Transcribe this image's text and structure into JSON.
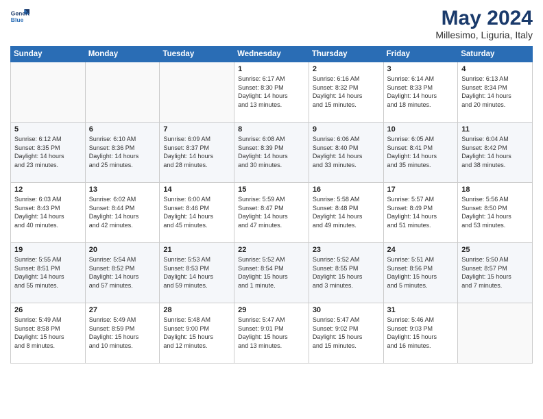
{
  "logo": {
    "text_line1": "General",
    "text_line2": "Blue"
  },
  "calendar": {
    "title": "May 2024",
    "subtitle": "Millesimo, Liguria, Italy",
    "days_of_week": [
      "Sunday",
      "Monday",
      "Tuesday",
      "Wednesday",
      "Thursday",
      "Friday",
      "Saturday"
    ],
    "weeks": [
      [
        {
          "day": "",
          "info": ""
        },
        {
          "day": "",
          "info": ""
        },
        {
          "day": "",
          "info": ""
        },
        {
          "day": "1",
          "info": "Sunrise: 6:17 AM\nSunset: 8:30 PM\nDaylight: 14 hours\nand 13 minutes."
        },
        {
          "day": "2",
          "info": "Sunrise: 6:16 AM\nSunset: 8:32 PM\nDaylight: 14 hours\nand 15 minutes."
        },
        {
          "day": "3",
          "info": "Sunrise: 6:14 AM\nSunset: 8:33 PM\nDaylight: 14 hours\nand 18 minutes."
        },
        {
          "day": "4",
          "info": "Sunrise: 6:13 AM\nSunset: 8:34 PM\nDaylight: 14 hours\nand 20 minutes."
        }
      ],
      [
        {
          "day": "5",
          "info": "Sunrise: 6:12 AM\nSunset: 8:35 PM\nDaylight: 14 hours\nand 23 minutes."
        },
        {
          "day": "6",
          "info": "Sunrise: 6:10 AM\nSunset: 8:36 PM\nDaylight: 14 hours\nand 25 minutes."
        },
        {
          "day": "7",
          "info": "Sunrise: 6:09 AM\nSunset: 8:37 PM\nDaylight: 14 hours\nand 28 minutes."
        },
        {
          "day": "8",
          "info": "Sunrise: 6:08 AM\nSunset: 8:39 PM\nDaylight: 14 hours\nand 30 minutes."
        },
        {
          "day": "9",
          "info": "Sunrise: 6:06 AM\nSunset: 8:40 PM\nDaylight: 14 hours\nand 33 minutes."
        },
        {
          "day": "10",
          "info": "Sunrise: 6:05 AM\nSunset: 8:41 PM\nDaylight: 14 hours\nand 35 minutes."
        },
        {
          "day": "11",
          "info": "Sunrise: 6:04 AM\nSunset: 8:42 PM\nDaylight: 14 hours\nand 38 minutes."
        }
      ],
      [
        {
          "day": "12",
          "info": "Sunrise: 6:03 AM\nSunset: 8:43 PM\nDaylight: 14 hours\nand 40 minutes."
        },
        {
          "day": "13",
          "info": "Sunrise: 6:02 AM\nSunset: 8:44 PM\nDaylight: 14 hours\nand 42 minutes."
        },
        {
          "day": "14",
          "info": "Sunrise: 6:00 AM\nSunset: 8:46 PM\nDaylight: 14 hours\nand 45 minutes."
        },
        {
          "day": "15",
          "info": "Sunrise: 5:59 AM\nSunset: 8:47 PM\nDaylight: 14 hours\nand 47 minutes."
        },
        {
          "day": "16",
          "info": "Sunrise: 5:58 AM\nSunset: 8:48 PM\nDaylight: 14 hours\nand 49 minutes."
        },
        {
          "day": "17",
          "info": "Sunrise: 5:57 AM\nSunset: 8:49 PM\nDaylight: 14 hours\nand 51 minutes."
        },
        {
          "day": "18",
          "info": "Sunrise: 5:56 AM\nSunset: 8:50 PM\nDaylight: 14 hours\nand 53 minutes."
        }
      ],
      [
        {
          "day": "19",
          "info": "Sunrise: 5:55 AM\nSunset: 8:51 PM\nDaylight: 14 hours\nand 55 minutes."
        },
        {
          "day": "20",
          "info": "Sunrise: 5:54 AM\nSunset: 8:52 PM\nDaylight: 14 hours\nand 57 minutes."
        },
        {
          "day": "21",
          "info": "Sunrise: 5:53 AM\nSunset: 8:53 PM\nDaylight: 14 hours\nand 59 minutes."
        },
        {
          "day": "22",
          "info": "Sunrise: 5:52 AM\nSunset: 8:54 PM\nDaylight: 15 hours\nand 1 minute."
        },
        {
          "day": "23",
          "info": "Sunrise: 5:52 AM\nSunset: 8:55 PM\nDaylight: 15 hours\nand 3 minutes."
        },
        {
          "day": "24",
          "info": "Sunrise: 5:51 AM\nSunset: 8:56 PM\nDaylight: 15 hours\nand 5 minutes."
        },
        {
          "day": "25",
          "info": "Sunrise: 5:50 AM\nSunset: 8:57 PM\nDaylight: 15 hours\nand 7 minutes."
        }
      ],
      [
        {
          "day": "26",
          "info": "Sunrise: 5:49 AM\nSunset: 8:58 PM\nDaylight: 15 hours\nand 8 minutes."
        },
        {
          "day": "27",
          "info": "Sunrise: 5:49 AM\nSunset: 8:59 PM\nDaylight: 15 hours\nand 10 minutes."
        },
        {
          "day": "28",
          "info": "Sunrise: 5:48 AM\nSunset: 9:00 PM\nDaylight: 15 hours\nand 12 minutes."
        },
        {
          "day": "29",
          "info": "Sunrise: 5:47 AM\nSunset: 9:01 PM\nDaylight: 15 hours\nand 13 minutes."
        },
        {
          "day": "30",
          "info": "Sunrise: 5:47 AM\nSunset: 9:02 PM\nDaylight: 15 hours\nand 15 minutes."
        },
        {
          "day": "31",
          "info": "Sunrise: 5:46 AM\nSunset: 9:03 PM\nDaylight: 15 hours\nand 16 minutes."
        },
        {
          "day": "",
          "info": ""
        }
      ]
    ]
  }
}
